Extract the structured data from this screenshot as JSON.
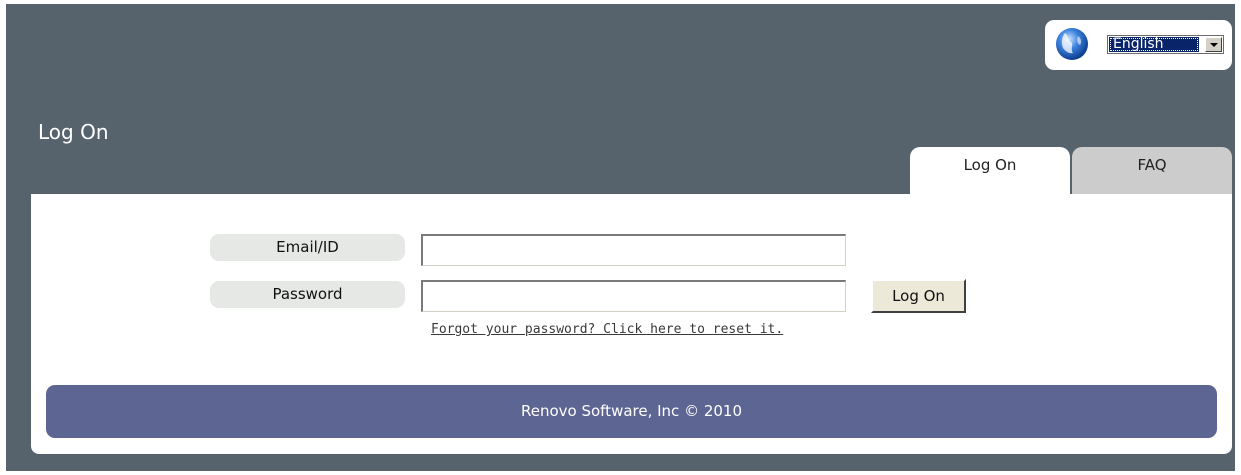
{
  "header": {
    "title": "Log On",
    "language": {
      "icon": "globe-icon",
      "selected": "English",
      "select_bg": "#0a246a"
    }
  },
  "tabs": [
    {
      "label": "Log On",
      "active": true
    },
    {
      "label": "FAQ",
      "active": false
    }
  ],
  "form": {
    "email_label": "Email/ID",
    "email_value": "",
    "password_label": "Password",
    "password_value": "",
    "submit_label": "Log On",
    "forgot_link": "Forgot your password? Click here to reset it."
  },
  "footer": {
    "text": "Renovo Software, Inc © 2010"
  },
  "colors": {
    "background": "#56636d",
    "footer": "#5d6592",
    "inactive_tab": "#cccccc",
    "label_bg": "#e6e8e6"
  }
}
